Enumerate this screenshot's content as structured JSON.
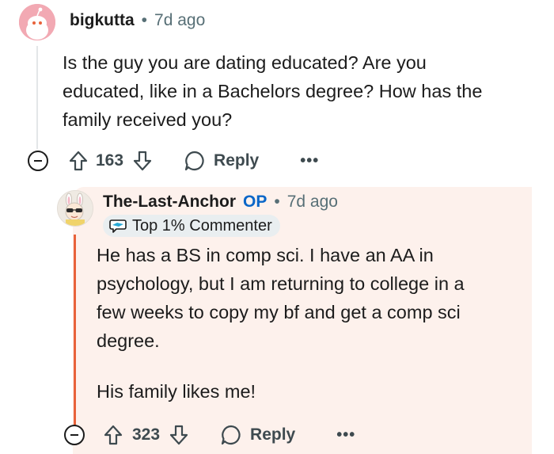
{
  "comment": {
    "username": "bigkutta",
    "separator": "•",
    "time": "7d ago",
    "body_lines": [
      "Is the guy you are dating educated? Are you",
      "educated, like in a Bachelors degree? How has the",
      "family received you?"
    ],
    "votes": "163",
    "reply_label": "Reply",
    "more_label": "•••",
    "avatar_icon": "snoo-avatar-icon"
  },
  "reply": {
    "username": "The-Last-Anchor",
    "op_label": "OP",
    "separator": "•",
    "time": "7d ago",
    "badge": "Top 1% Commenter",
    "body_lines": [
      "He has a BS in comp sci. I have an AA in",
      "psychology, but I am returning to college in a",
      "few weeks to copy my bf and get a comp sci",
      "degree."
    ],
    "body_line_2": "His family likes me!",
    "votes": "323",
    "reply_label": "Reply",
    "more_label": "•••",
    "avatar_icon": "custom-avatar-icon"
  },
  "colors": {
    "highlight_bg": "#fdf1ec",
    "thread_accent": "#e8623a",
    "op_blue": "#0a66c8"
  }
}
